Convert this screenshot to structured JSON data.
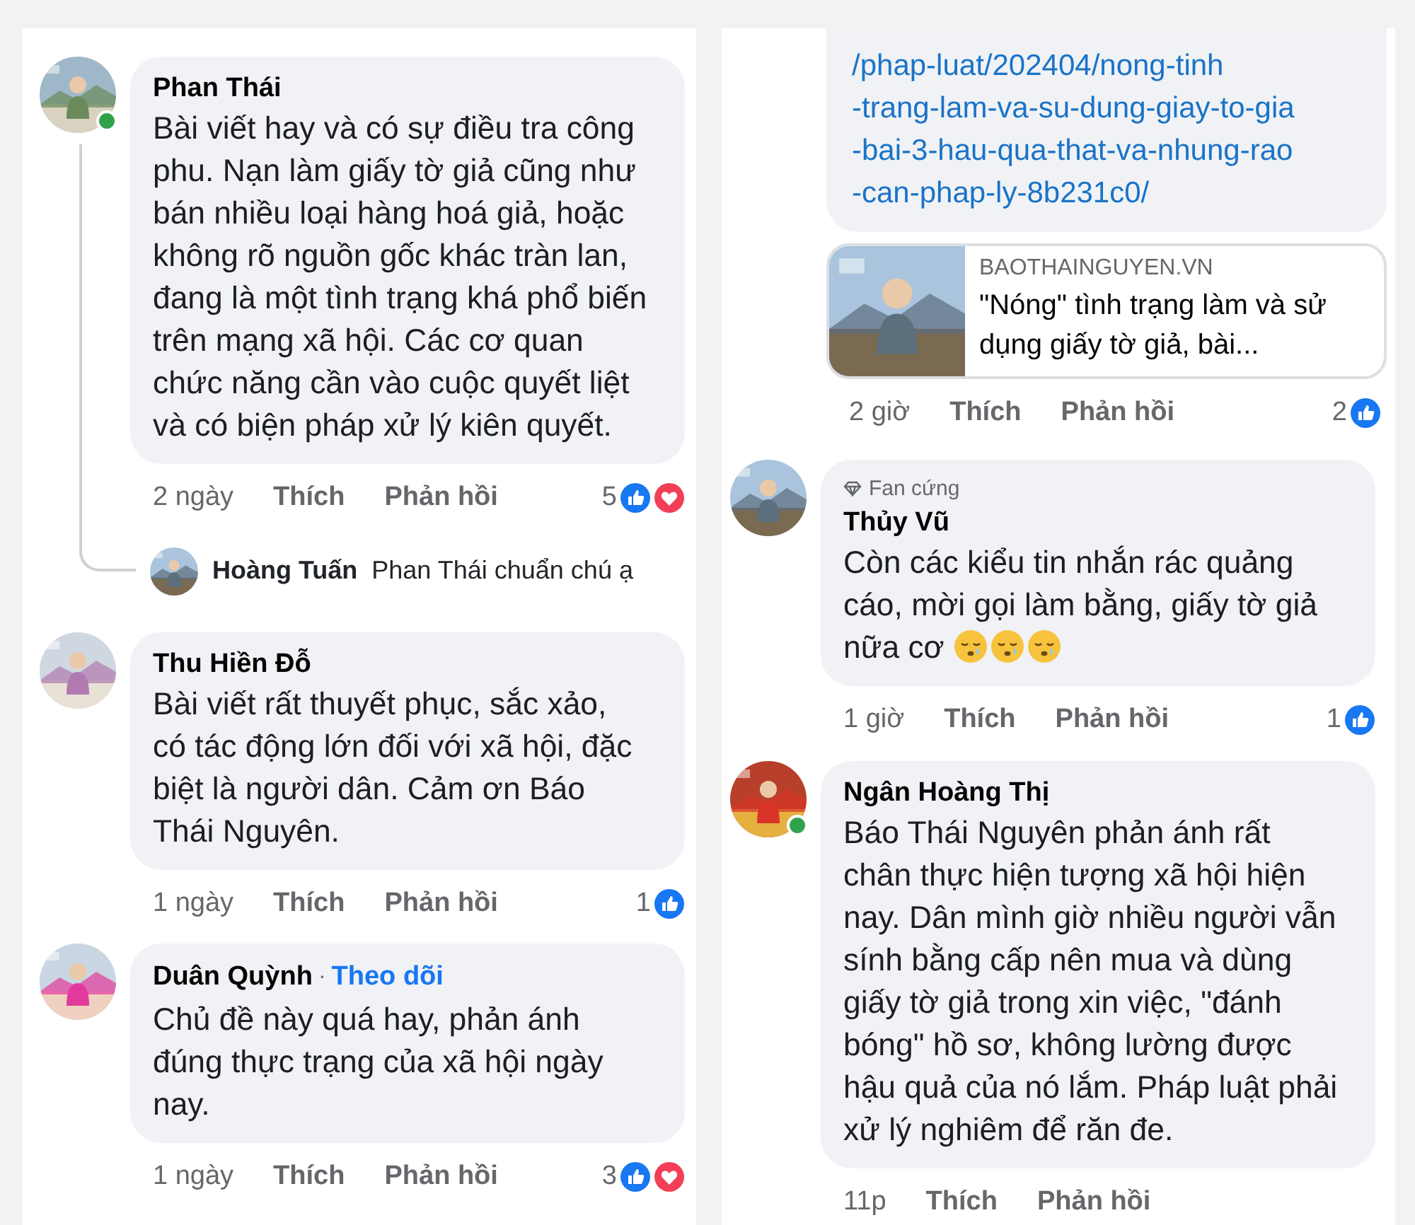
{
  "columns": [
    {
      "comments": [
        {
          "name": "Phan Thái",
          "online": true,
          "text": "Bài viết hay và có sự điều tra công phu. Nạn làm giấy tờ giả cũng như bán nhiều loại hàng hoá giả, hoặc không rõ nguồn gốc khác tràn lan, đang là một tình trạng khá phổ biến trên mạng xã hội. Các cơ quan chức năng cần vào cuộc quyết liệt và có biện pháp xử lý kiên quyết.",
          "time": "2 ngày",
          "like": "Thích",
          "reply": "Phản hồi",
          "reaction_count": "5",
          "reactions": [
            {
              "kind": "like"
            },
            {
              "kind": "love"
            }
          ],
          "replies_preview": {
            "author": "Hoàng Tuấn",
            "text": "Phan Thái chuẩn chú ạ"
          }
        },
        {
          "name": "Thu Hiền Đỗ",
          "online": false,
          "text": "Bài viết rất thuyết phục, sắc xảo, có tác động lớn đối với xã hội, đặc biệt là người dân. Cảm ơn Báo Thái Nguyên.",
          "time": "1 ngày",
          "like": "Thích",
          "reply": "Phản hồi",
          "reaction_count": "1",
          "reactions": [
            {
              "kind": "like"
            }
          ]
        },
        {
          "name": "Duân Quỳnh",
          "separator": "·",
          "follow": "Theo dõi",
          "online": false,
          "text": "Chủ đề này quá hay,  phản ánh đúng thực trạng của xã hội ngày nay.",
          "time": "1 ngày",
          "like": "Thích",
          "reply": "Phản hồi",
          "reaction_count": "3",
          "reactions": [
            {
              "kind": "like"
            },
            {
              "kind": "love"
            }
          ]
        }
      ]
    },
    {
      "link_bubble": {
        "url_lines": [
          "/phap-luat/202404/nong-tinh",
          "-trang-lam-va-su-dung-giay-to-gia",
          "-bai-3-hau-qua-that-va-nhung-rao",
          "-can-phap-ly-8b231c0/"
        ],
        "preview": {
          "kind": "picture",
          "domain": "BAOTHAINGUYEN.VN",
          "title": "\"Nóng\" tình trạng làm và sử dụng giấy tờ giả, bài..."
        },
        "time": "2 giờ",
        "like": "Thích",
        "reply": "Phản hồi",
        "reaction_count": "2",
        "reactions": [
          {
            "kind": "like"
          }
        ]
      },
      "comments": [
        {
          "badge": "Fan cứng",
          "name": "Thủy Vũ",
          "online": false,
          "text": "Còn các kiểu tin nhắn rác quảng cáo, mời gọi làm bằng, giấy tờ giả nữa cơ",
          "emojis": [
            {
              "kind": "sleepy"
            },
            {
              "kind": "sleepy"
            },
            {
              "kind": "sleepy"
            }
          ],
          "time": "1 giờ",
          "like": "Thích",
          "reply": "Phản hồi",
          "reaction_count": "1",
          "reactions": [
            {
              "kind": "like"
            }
          ]
        },
        {
          "name": "Ngân Hoàng Thị",
          "online": true,
          "text": "Báo Thái Nguyên phản ánh rất chân thực hiện tượng xã hội hiện nay. Dân mình giờ nhiều người vẫn sính bằng cấp nên mua và dùng giấy tờ giả trong xin việc, \"đánh bóng\" hồ sơ, không lường được hậu quả của nó lắm. Pháp luật phải xử lý nghiêm để răn đe.",
          "time": "11p",
          "like": "Thích",
          "reply": "Phản hồi"
        }
      ]
    }
  ]
}
